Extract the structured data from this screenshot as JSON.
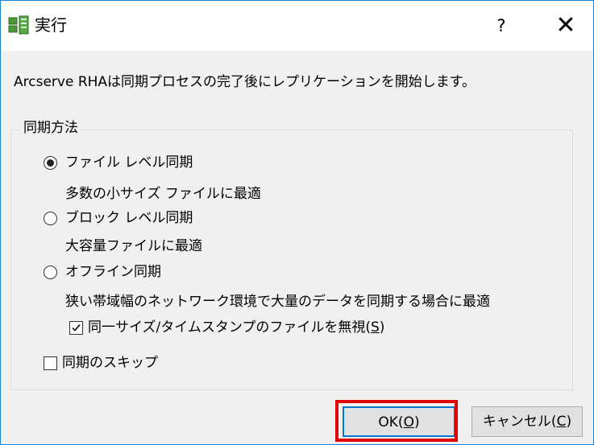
{
  "window": {
    "title": "実行",
    "help_label": "?",
    "close_label": "✕"
  },
  "description": "Arcserve RHAは同期プロセスの完了後にレプリケーションを開始します。",
  "sync_group": {
    "legend": "同期方法",
    "options": [
      {
        "label": "ファイル レベル同期",
        "description": "多数の小サイズ ファイルに最適",
        "selected": true
      },
      {
        "label": "ブロック レベル同期",
        "description": "大容量ファイルに最適",
        "selected": false
      },
      {
        "label": "オフライン同期",
        "description": "狭い帯域幅のネットワーク環境で大量のデータを同期する場合に最適",
        "selected": false
      }
    ],
    "ignore_same_files": {
      "label_prefix": "同一サイズ/タイムスタンプのファイルを無視(",
      "mnemonic": "S",
      "label_suffix": ")",
      "checked": true
    },
    "skip_sync": {
      "label": "同期のスキップ",
      "checked": false
    }
  },
  "buttons": {
    "ok": {
      "prefix": "OK(",
      "mnemonic": "O",
      "suffix": ")"
    },
    "cancel": {
      "prefix": "キャンセル(",
      "mnemonic": "C",
      "suffix": ")"
    }
  },
  "colors": {
    "highlight": "#e00000",
    "window_border": "#1883d7"
  }
}
